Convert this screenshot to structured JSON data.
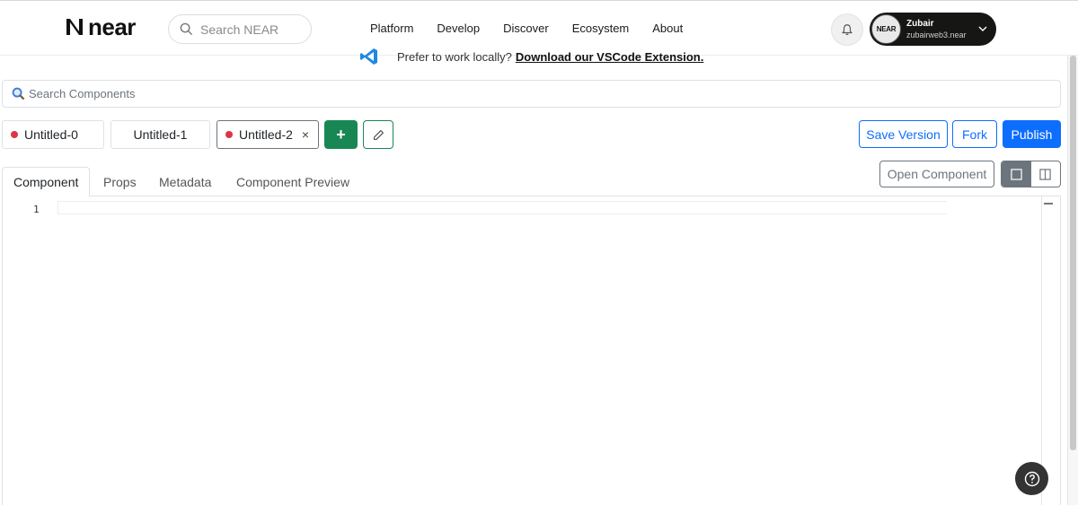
{
  "nav": {
    "logo_text": "near",
    "search_placeholder": "Search NEAR",
    "links": [
      "Platform",
      "Develop",
      "Discover",
      "Ecosystem",
      "About"
    ],
    "user": {
      "avatar_text": "NEAR",
      "name": "Zubair",
      "account": "zubairweb3.near"
    }
  },
  "banner": {
    "text": "Prefer to work locally?",
    "link": "Download our VSCode Extension."
  },
  "component_search": {
    "placeholder": "Search Components"
  },
  "file_tabs": [
    {
      "label": "Untitled-0",
      "unsaved": true
    },
    {
      "label": "Untitled-1",
      "unsaved": false
    },
    {
      "label": "Untitled-2",
      "unsaved": true,
      "active": true,
      "close": "×"
    }
  ],
  "toolbar": {
    "add_label": "+",
    "save_version": "Save Version",
    "fork": "Fork",
    "publish": "Publish"
  },
  "editor_tabs": [
    "Component",
    "Props",
    "Metadata",
    "Component Preview"
  ],
  "open_component": "Open Component",
  "editor": {
    "line_numbers": [
      "1"
    ]
  },
  "colors": {
    "primary": "#0d6efd",
    "success": "#198754",
    "danger": "#dc3545",
    "secondary": "#6c757d",
    "dark": "#161615"
  }
}
